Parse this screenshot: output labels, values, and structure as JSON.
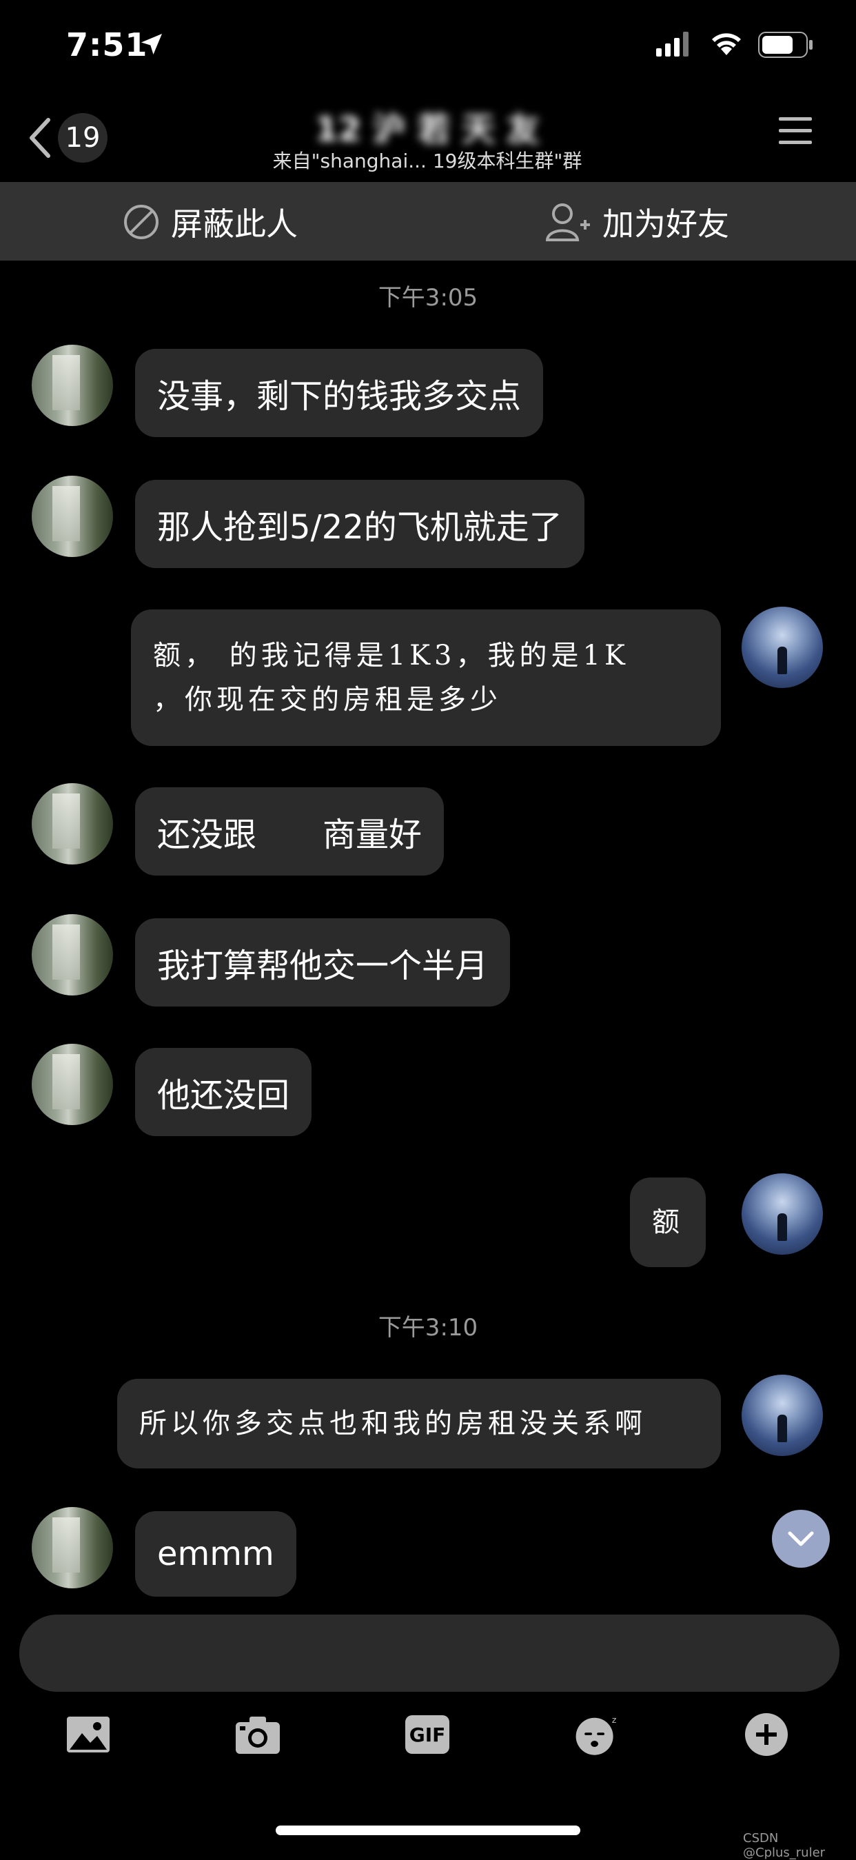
{
  "status_bar": {
    "time": "7:51"
  },
  "header": {
    "back_count": "19",
    "title": "12 沪 若 天 友",
    "subtitle": "来自\"shanghai... 19级本科生群\"群"
  },
  "actions": {
    "block": "屏蔽此人",
    "add_friend": "加为好友"
  },
  "messages": [
    {
      "type": "time",
      "text": "下午3:05"
    },
    {
      "type": "friend",
      "text": "没事，剩下的钱我多交点"
    },
    {
      "type": "friend",
      "text": "那人抢到5/22的飞机就走了"
    },
    {
      "type": "me",
      "lines": [
        "额，  的我记得是1K3，我的是1K",
        "，你现在交的房租是多少"
      ]
    },
    {
      "type": "friend",
      "text": "还没跟　　商量好"
    },
    {
      "type": "friend",
      "text": "我打算帮他交一个半月"
    },
    {
      "type": "friend",
      "text": "他还没回"
    },
    {
      "type": "me",
      "text": "额"
    },
    {
      "type": "time",
      "text": "下午3:10"
    },
    {
      "type": "me",
      "text": "所以你多交点也和我的房租没关系啊"
    },
    {
      "type": "friend",
      "text": "emmm"
    }
  ],
  "input": {
    "placeholder": ""
  },
  "toolbar": [
    "image-icon",
    "camera-icon",
    "gif-icon",
    "sticker-icon",
    "plus-icon"
  ],
  "toolbar_labels": {
    "gif": "GIF"
  },
  "watermark": "CSDN @Cplus_ruler"
}
